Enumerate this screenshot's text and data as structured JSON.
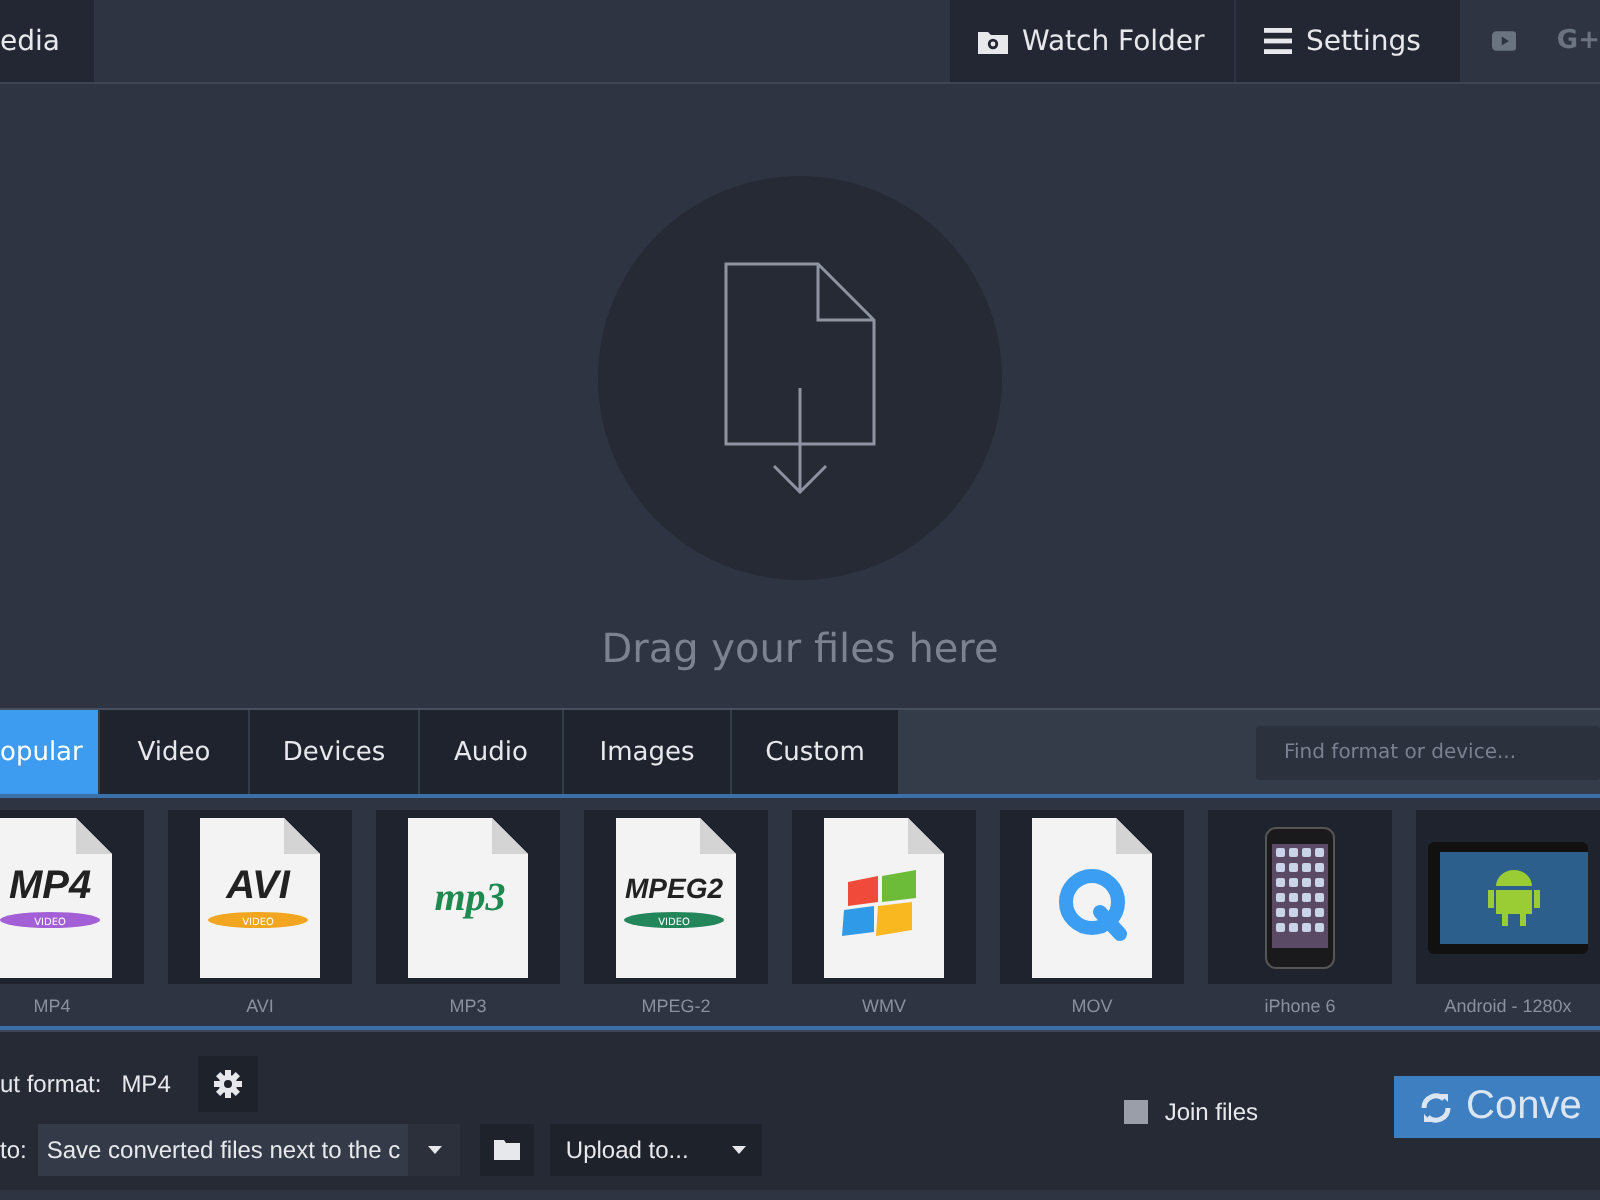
{
  "top_bar": {
    "left_tab": "edia",
    "buttons": [
      {
        "kind": "folder",
        "label": "Watch Folder"
      },
      {
        "kind": "menu",
        "label": "Settings"
      }
    ],
    "social": [
      {
        "kind": "youtube"
      },
      {
        "kind": "gplus",
        "label": "G+"
      }
    ]
  },
  "drop_zone": {
    "text": "Drag your files here"
  },
  "tabs": [
    {
      "label": "opular",
      "selected": true
    },
    {
      "label": "Video",
      "selected": false
    },
    {
      "label": "Devices",
      "selected": false
    },
    {
      "label": "Audio",
      "selected": false
    },
    {
      "label": "Images",
      "selected": false
    },
    {
      "label": "Custom",
      "selected": false
    }
  ],
  "search": {
    "placeholder": "Find format or device..."
  },
  "formats": [
    {
      "label": "MP4",
      "kind": "doc-text",
      "logo": "MP4",
      "band": "VIDEO",
      "color": "#a35fd6"
    },
    {
      "label": "AVI",
      "kind": "doc-text",
      "logo": "AVI",
      "band": "VIDEO",
      "color": "#f2a51f"
    },
    {
      "label": "MP3",
      "kind": "doc-script",
      "logo": "mp3",
      "color": "#1e8a4f"
    },
    {
      "label": "MPEG-2",
      "kind": "doc-text",
      "logo": "MPEG2",
      "band": "VIDEO",
      "color": "#22865a"
    },
    {
      "label": "WMV",
      "kind": "doc-windows"
    },
    {
      "label": "MOV",
      "kind": "doc-q"
    },
    {
      "label": "iPhone 6",
      "kind": "phone"
    },
    {
      "label": "Android - 1280x",
      "kind": "tablet"
    }
  ],
  "output": {
    "label": "ut format:",
    "value": "MP4"
  },
  "save": {
    "label": "to:",
    "value": "Save converted files next to the c",
    "upload": "Upload to..."
  },
  "join_files": {
    "label": "Join files",
    "checked": false
  },
  "convert": {
    "label": "Conve"
  }
}
